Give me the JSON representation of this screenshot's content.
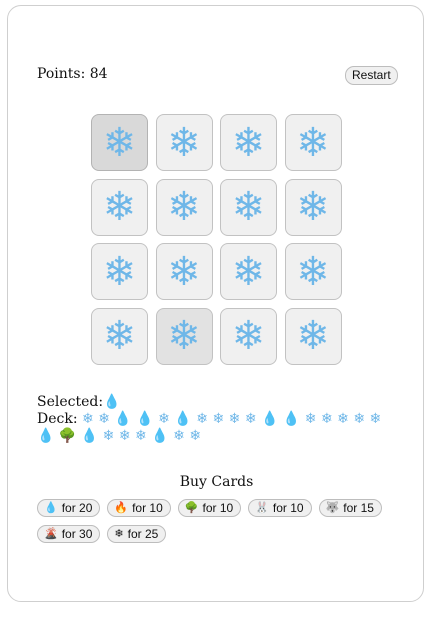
{
  "score": {
    "label": "Points: 84"
  },
  "controls": {
    "restart_label": "Restart"
  },
  "board": {
    "tiles": [
      "❄",
      "❄",
      "❄",
      "❄",
      "❄",
      "❄",
      "❄",
      "❄",
      "❄",
      "❄",
      "❄",
      "❄",
      "❄",
      "❄",
      "❄",
      "❄"
    ]
  },
  "selected": {
    "label": "Selected:",
    "card": "💧"
  },
  "deck": {
    "label": "Deck:",
    "cards": [
      "❄",
      "❄",
      "💧",
      "💧",
      "❄",
      "💧",
      "❄",
      "❄",
      "❄",
      "❄",
      "💧",
      "💧",
      "❄",
      "❄",
      "❄",
      "❄",
      "❄",
      "💧",
      "🌳",
      "💧",
      "❄",
      "❄",
      "❄",
      "💧",
      "❄",
      "❄"
    ]
  },
  "shop": {
    "title": "Buy Cards",
    "items": [
      {
        "icon": "💧",
        "label": "for 20"
      },
      {
        "icon": "🔥",
        "label": "for 10"
      },
      {
        "icon": "🌳",
        "label": "for 10"
      },
      {
        "icon": "🐰",
        "label": "for 10"
      },
      {
        "icon": "🐺",
        "label": "for 15"
      },
      {
        "icon": "🌋",
        "label": "for 30"
      },
      {
        "icon": "❄",
        "label": "for 25"
      }
    ]
  }
}
